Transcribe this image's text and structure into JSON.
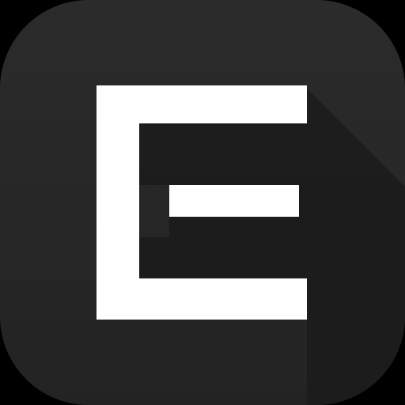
{
  "app_icon": {
    "icon_name": "letter-e-logo-icon",
    "colors": {
      "background": "#000000",
      "tile": "#232323",
      "tile_highlight": "#2b2b2b",
      "long_shadow": "#1b1b1b",
      "glyph": "#ffffff"
    }
  }
}
